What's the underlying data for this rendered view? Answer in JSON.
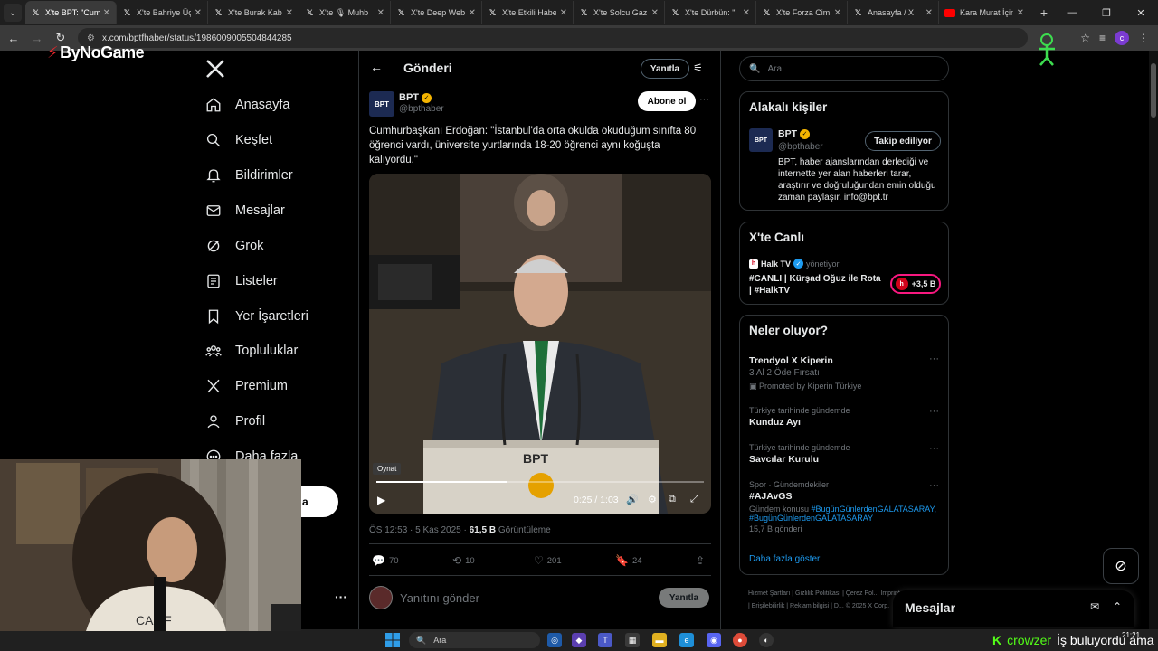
{
  "browser": {
    "tabs": [
      {
        "label": "X'te BPT: \"Cum",
        "active": true
      },
      {
        "label": "X'te Bahriye Üç",
        "active": false
      },
      {
        "label": "X'te Burak Kab",
        "active": false
      },
      {
        "label": "X'te 🎙 Muhb",
        "active": false
      },
      {
        "label": "X'te Deep Web",
        "active": false
      },
      {
        "label": "X'te Etkili Habe",
        "active": false
      },
      {
        "label": "X'te Solcu Gaz",
        "active": false
      },
      {
        "label": "X'te Dürbün: \"",
        "active": false
      },
      {
        "label": "X'te Forza Cim",
        "active": false
      },
      {
        "label": "Anasayfa / X",
        "active": false
      },
      {
        "label": "Kara Murat İçin",
        "active": false
      }
    ],
    "url": "x.com/bptfhaber/status/1986009005504844285"
  },
  "watermark": {
    "brand": "ByNoGame"
  },
  "nav": {
    "items": [
      {
        "label": "Anasayfa",
        "icon": "home-icon"
      },
      {
        "label": "Keşfet",
        "icon": "search-icon"
      },
      {
        "label": "Bildirimler",
        "icon": "bell-icon"
      },
      {
        "label": "Mesajlar",
        "icon": "mail-icon"
      },
      {
        "label": "Grok",
        "icon": "grok-icon"
      },
      {
        "label": "Listeler",
        "icon": "list-icon"
      },
      {
        "label": "Yer İşaretleri",
        "icon": "bookmark-icon"
      },
      {
        "label": "Topluluklar",
        "icon": "communities-icon"
      },
      {
        "label": "Premium",
        "icon": "x-premium-icon"
      },
      {
        "label": "Profil",
        "icon": "profile-icon"
      },
      {
        "label": "Daha fazla",
        "icon": "more-circle-icon"
      }
    ],
    "post_button_label": "a"
  },
  "main": {
    "header_title": "Gönderi",
    "reply_top_label": "Yanıtla",
    "author_name": "BPT",
    "author_handle": "@bpthaber",
    "subscribe_label": "Abone ol",
    "post_text": "Cumhurbaşkanı Erdoğan: \"İstanbul'da orta okulda okuduğum sınıfta 80 öğrenci vardı, üniversite yurtlarında 18-20 öğrenci aynı koğuşta kalıyordu.\"",
    "video": {
      "tooltip": "Oynat",
      "time": "0:25 / 1:03",
      "progress": 0.397
    },
    "meta_time": "ÖS 12:53 · 5 Kas 2025 · ",
    "meta_views": "61,5 B",
    "meta_views_label": " Görüntüleme",
    "stats": {
      "replies": "70",
      "reposts": "10",
      "likes": "201",
      "bookmarks": "24"
    },
    "reply_placeholder": "Yanıtını gönder",
    "reply_send_label": "Yanıtla"
  },
  "right": {
    "search_placeholder": "Ara",
    "related": {
      "title": "Alakalı kişiler",
      "name": "BPT",
      "handle": "@bpthaber",
      "follow_label": "Takip ediliyor",
      "bio": "BPT, haber ajanslarından derlediği ve internette yer alan haberleri tarar, araştırır ve doğruluğundan emin olduğu zaman paylaşır. info@bpt.tr"
    },
    "live": {
      "title": "X'te Canlı",
      "host": "Halk TV",
      "host_role": "yönetiyor",
      "stream_title": "#CANLI | Kürşad Oğuz ile Rota | #HalkTV",
      "listeners": "+3,5 B"
    },
    "trends": {
      "title": "Neler oluyor?",
      "items": [
        {
          "meta": "",
          "name": "Trendyol X Kiperin",
          "sub": "3 Al 2 Öde Fırsatı",
          "promo": "Promoted by Kiperin Türkiye"
        },
        {
          "meta": "Türkiye tarihinde gündemde",
          "name": "Kunduz Ayı",
          "sub": "",
          "promo": ""
        },
        {
          "meta": "Türkiye tarihinde gündemde",
          "name": "Savcılar Kurulu",
          "sub": "",
          "promo": ""
        },
        {
          "meta": "Spor · Gündemdekiler",
          "name": "#AJAvGS",
          "sub": "Gündem konusu ",
          "links": "#BugünGünlerdenGALATASARAY, #BugünGünlerdenGALATASARAY",
          "count": "15,7 B gönderi"
        }
      ],
      "show_more": "Daha fazla göster"
    },
    "footer": "Hizmet Şartları | Gizlilik Politikası | Çerez Pol... Imprint | Erişilebilirlik | Reklam bilgisi | D... © 2025 X Corp."
  },
  "messages_dock": {
    "title": "Mesajlar"
  },
  "taskbar": {
    "search_label": "Ara",
    "time": "21:21"
  },
  "overlay": {
    "user": "crowzer",
    "message": "İş buluyordu ama"
  },
  "colors": {
    "accent": "#1d9bf0",
    "verified": "#f4b400",
    "live": "#f91880",
    "kick": "#53fc18"
  }
}
